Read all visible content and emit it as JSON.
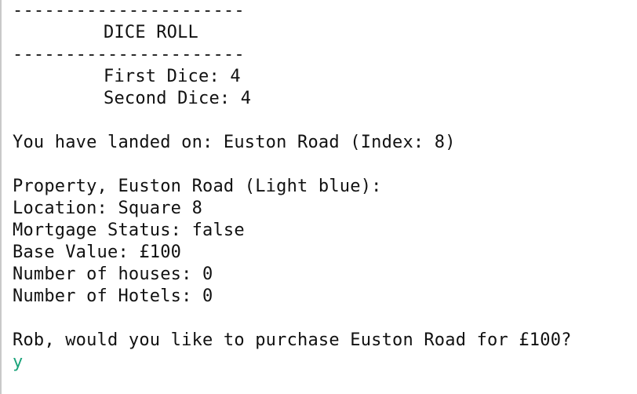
{
  "console": {
    "lines": [
      {
        "text": "----------------------",
        "indent": false
      },
      {
        "text": "DICE ROLL",
        "indent": true
      },
      {
        "text": "----------------------",
        "indent": false
      },
      {
        "text": "First Dice: 4",
        "indent": true
      },
      {
        "text": "Second Dice: 4",
        "indent": true
      },
      {
        "text": "",
        "indent": false
      },
      {
        "text": "You have landed on: Euston Road (Index: 8)",
        "indent": false
      },
      {
        "text": "",
        "indent": false
      },
      {
        "text": "Property, Euston Road (Light blue):",
        "indent": false
      },
      {
        "text": "Location: Square 8",
        "indent": false
      },
      {
        "text": "Mortgage Status: false",
        "indent": false
      },
      {
        "text": "Base Value: £100",
        "indent": false
      },
      {
        "text": "Number of houses: 0",
        "indent": false
      },
      {
        "text": "Number of Hotels: 0",
        "indent": false
      },
      {
        "text": "",
        "indent": false
      },
      {
        "text": "Rob, would you like to purchase Euston Road for £100?",
        "indent": false
      }
    ],
    "user_input": "y",
    "colors": {
      "text": "#111111",
      "input": "#1aa37a",
      "background": "#ffffff"
    }
  }
}
